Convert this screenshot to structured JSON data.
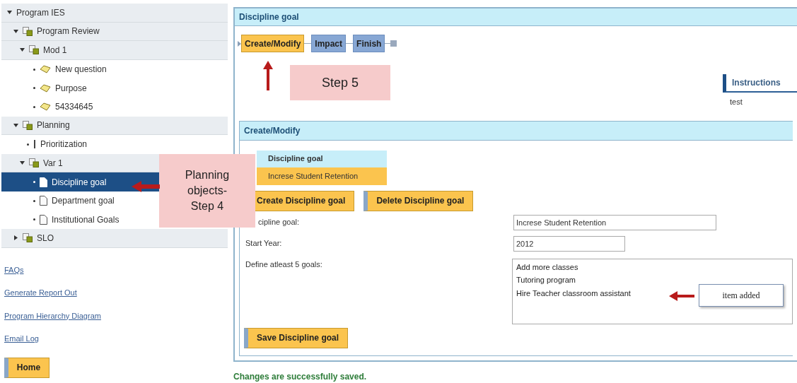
{
  "tree": [
    {
      "label": "Program IES",
      "kind": "root",
      "expanded": true,
      "selected": false,
      "children": [
        {
          "label": "Program Review",
          "kind": "group",
          "expanded": true,
          "selected": false,
          "children": [
            {
              "label": "Mod 1",
              "kind": "group",
              "expanded": true,
              "selected": false,
              "children": [
                {
                  "label": "New question",
                  "kind": "question",
                  "selected": false
                },
                {
                  "label": "Purpose",
                  "kind": "question",
                  "selected": false
                },
                {
                  "label": "54334645",
                  "kind": "question",
                  "selected": false
                }
              ]
            }
          ]
        },
        {
          "label": "Planning",
          "kind": "group",
          "expanded": true,
          "selected": false,
          "children": [
            {
              "label": "Prioritization",
              "kind": "priority",
              "selected": false
            },
            {
              "label": "Var 1",
              "kind": "group",
              "expanded": true,
              "selected": false,
              "children": [
                {
                  "label": "Discipline goal",
                  "kind": "document",
                  "selected": true
                },
                {
                  "label": "Department goal",
                  "kind": "document",
                  "selected": false
                },
                {
                  "label": "Institutional Goals",
                  "kind": "document",
                  "selected": false
                }
              ]
            }
          ]
        },
        {
          "label": "SLO",
          "kind": "group",
          "expanded": false,
          "selected": false
        }
      ]
    }
  ],
  "links": [
    "FAQs",
    "Generate Report Out",
    "Program Hierarchy Diagram",
    "Email Log"
  ],
  "home_button": "Home",
  "panel": {
    "title": "Discipline goal",
    "steps": [
      {
        "label": "Create/Modify",
        "selected": true
      },
      {
        "label": "Impact",
        "selected": false
      },
      {
        "label": "Finish",
        "selected": false
      }
    ],
    "instructions": {
      "title": "Instructions",
      "text": "test"
    },
    "section": {
      "title": "Create/Modify",
      "goal_list": {
        "header": "Discipline goal",
        "items": [
          {
            "label": "Increse Student Retention",
            "selected": true
          }
        ]
      },
      "buttons": [
        "Create Discipline goal",
        "Delete Discipline goal"
      ],
      "fields": [
        {
          "label": "cipline goal:",
          "value": "Increse Student Retention"
        },
        {
          "label": "Start Year:",
          "value": "2012"
        }
      ],
      "goals": {
        "label": "Define atleast 5 goals:",
        "items": [
          "Add more classes",
          "Tutoring program",
          "Hire Teacher classroom assistant"
        ]
      },
      "save_button": "Save Discipline goal"
    },
    "status": "Changes are successfully saved."
  },
  "callouts": [
    {
      "kind": "planning",
      "text": "Planning objects-Step 4"
    },
    {
      "kind": "step",
      "text": "Step 5"
    },
    {
      "kind": "tooltip",
      "text": "item added"
    }
  ]
}
